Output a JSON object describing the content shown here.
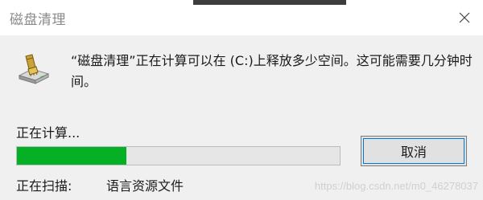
{
  "window": {
    "title": "磁盘清理"
  },
  "dialog": {
    "message": "“磁盘清理”正在计算可以在 (C:)上释放多少空间。这可能需要几分钟时间。",
    "status": "正在计算...",
    "progress_fraction": 0.34,
    "scan_label": "正在扫描:",
    "scan_item": "语言资源文件",
    "cancel_label": "取消"
  },
  "icons": {
    "close": "close-icon",
    "app": "disk-cleanup-icon"
  },
  "colors": {
    "progress_fill": "#06b025",
    "progress_track": "#e6e6e6",
    "button_focus": "#0078d7",
    "title_text": "#8a8a8a"
  },
  "watermark": "https://blog.csdn.net/m0_46278037"
}
